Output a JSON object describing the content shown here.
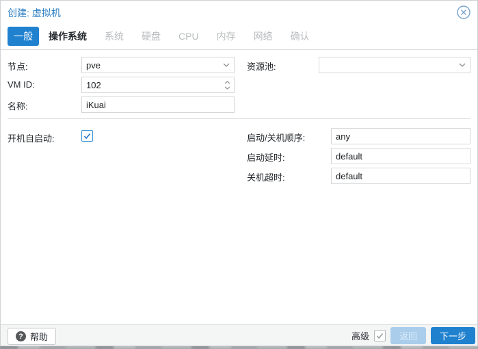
{
  "window": {
    "title": "创建: 虚拟机"
  },
  "tabs": [
    {
      "label": "一般",
      "state": "active"
    },
    {
      "label": "操作系统",
      "state": "enabled"
    },
    {
      "label": "系统",
      "state": "disabled"
    },
    {
      "label": "硬盘",
      "state": "disabled"
    },
    {
      "label": "CPU",
      "state": "disabled"
    },
    {
      "label": "内存",
      "state": "disabled"
    },
    {
      "label": "网络",
      "state": "disabled"
    },
    {
      "label": "确认",
      "state": "disabled"
    }
  ],
  "form": {
    "node": {
      "label": "节点:",
      "value": "pve",
      "control": "combobox"
    },
    "vmid": {
      "label": "VM ID:",
      "value": "102",
      "control": "spinner"
    },
    "name": {
      "label": "名称:",
      "value": "iKuai",
      "control": "text"
    },
    "pool": {
      "label": "资源池:",
      "value": "",
      "control": "combobox"
    },
    "onboot": {
      "label": "开机自启动:",
      "checked": true
    },
    "startup_order": {
      "label": "启动/关机顺序:",
      "value": "any"
    },
    "startup_delay": {
      "label": "启动延时:",
      "value": "default"
    },
    "shutdown_timeout": {
      "label": "关机超时:",
      "value": "default"
    }
  },
  "footer": {
    "help_label": "帮助",
    "help_icon_glyph": "?",
    "advanced_label": "高级",
    "advanced_checked": true,
    "back_label": "返回",
    "next_label": "下一步"
  },
  "colors": {
    "accent_blue": "#2081cf",
    "title_blue": "#2d7fc4",
    "disabled_button_bg": "#a9cdeb",
    "disabled_tab_text": "#b9bcbe"
  }
}
